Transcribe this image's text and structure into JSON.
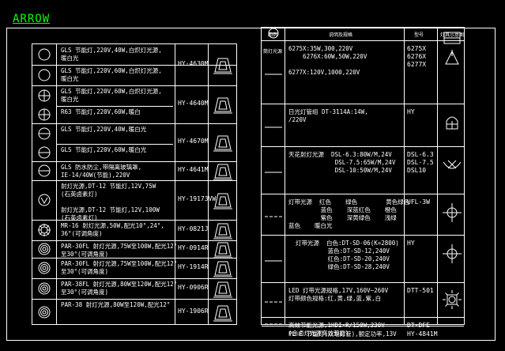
{
  "title": "ARROW",
  "left_rows": [
    {
      "lines": [
        "GLS 节能灯,220V,40W,白炽灯光源,",
        "暖白光"
      ],
      "symbol": "circle"
    },
    {
      "lines": [
        "GLS 节能灯,220V,60W,白炽灯光源,",
        "暖白光"
      ],
      "symbol": "circle"
    },
    {
      "lines": [
        "GLS 节能灯,220V,60W,白炽灯光源,",
        "暖白光"
      ],
      "symbol": "circle-cross"
    },
    {
      "lines": [
        "R63 节能灯,220V,60W,暖白"
      ],
      "symbol": "circle-cross"
    },
    {
      "lines": [
        "GLS 节能灯,220V,40W,暖白光"
      ],
      "symbol": "circle-hline"
    },
    {
      "lines": [
        "GLS 节能灯,220V,60W,暖白光"
      ],
      "symbol": "circle-hline"
    },
    {
      "lines": [
        "GLS 防水防尘,带隔离玻璃罩,",
        "IE-14/40W(节能),220V"
      ],
      "symbol": "circle-hline"
    },
    {
      "lines": [
        "射灯光源,DT-12 节能灯,12V,75W",
        "(石英卤素灯)",
        "",
        "射灯光源,DT-12 节能灯,12V,100W",
        "(石英卤素灯)"
      ],
      "symbol": "circle-v"
    },
    {
      "lines": [
        "MR-16 射灯光源,50W,配光10°,24°,",
        "36°(可调角度)"
      ],
      "symbol": "star-circle"
    },
    {
      "lines": [
        "PAR-30FL 射灯光源,75W至100W,配光12°",
        "至30°(可调角度)"
      ],
      "symbol": "concentric"
    },
    {
      "lines": [
        "PAR-30FL 射灯光源,75W至100W,配光12°",
        "至30°(可调角度)"
      ],
      "symbol": "concentric"
    },
    {
      "lines": [
        "PAR-38FL 射灯光源,80W至120W,配光12°",
        "至30°(可调角度)"
      ],
      "symbol": "concentric"
    },
    {
      "lines": [
        "PAR-38 射灯光源,80W至120W,配光12°"
      ],
      "symbol": "concentric"
    }
  ],
  "left_models": [
    "HY-4630M",
    "HY-4640M",
    "HY-4670M",
    "HY-4641M",
    "HY-19173VW",
    "HY-0821J",
    "HY-0914R",
    "HY-1914R",
    "HY-0906R",
    "HY-1906R"
  ],
  "right_headers": [
    "图例",
    "说明及规格",
    "型号",
    "灯具示意图"
  ],
  "right_rows": [
    {
      "label": "筒灯光源",
      "lines": [
        "6275X:35W,300,220V",
        "    6276X:60W,50W,220V",
        "",
        "6277X:120V,1000,220V"
      ],
      "model": "6275X\n6276X\n6277X"
    },
    {
      "label": "",
      "lines": [
        "日光灯管组 DT-3114A:14W,",
        "/220V"
      ],
      "model": "HY"
    },
    {
      "label": "",
      "lines": [
        "天花射灯光源  DSL-6.3:80W/M,24V",
        "             DSL-7.5:65W/M,24V",
        "             DSL-10:50W/M,24V"
      ],
      "model": "DSL-6.3\nDSL-7.5\nDSL10"
    },
    {
      "label": "",
      "lines": [
        "灯带光源  红色    绿色        黄色绿色",
        "         蓝色    深蓝红色    橙色",
        "         紫色    深黄绿色    浅绿",
        "蓝色    暖白光"
      ],
      "model": "UFL-3W"
    },
    {
      "label": "",
      "lines": [
        "  灯带光源  白色:DT-SD-06(K=2800)",
        "           蓝色:DT-SD-12,240V",
        "           红色:DT-SD-20,240V",
        "           绿色:DT-SD-28,240V"
      ],
      "model": "HY"
    },
    {
      "label": "",
      "lines": [
        "LED 灯带光源规格,17V,160V~260V",
        "灯带颜色规格:红,黄,绿,蓝,紫,白"
      ],
      "model": "DTT-501"
    },
    {
      "label": "",
      "lines": [
        "高效节能光源,1HDI-R/150W,230V",
        "(金卤灯光源高效节能)"
      ],
      "model": "DT-DFE"
    },
    {
      "label": "",
      "lines": [
        "PL-C 节能灯(双端灯管),额定功率,13V"
      ],
      "model": "HY-4841M"
    }
  ]
}
